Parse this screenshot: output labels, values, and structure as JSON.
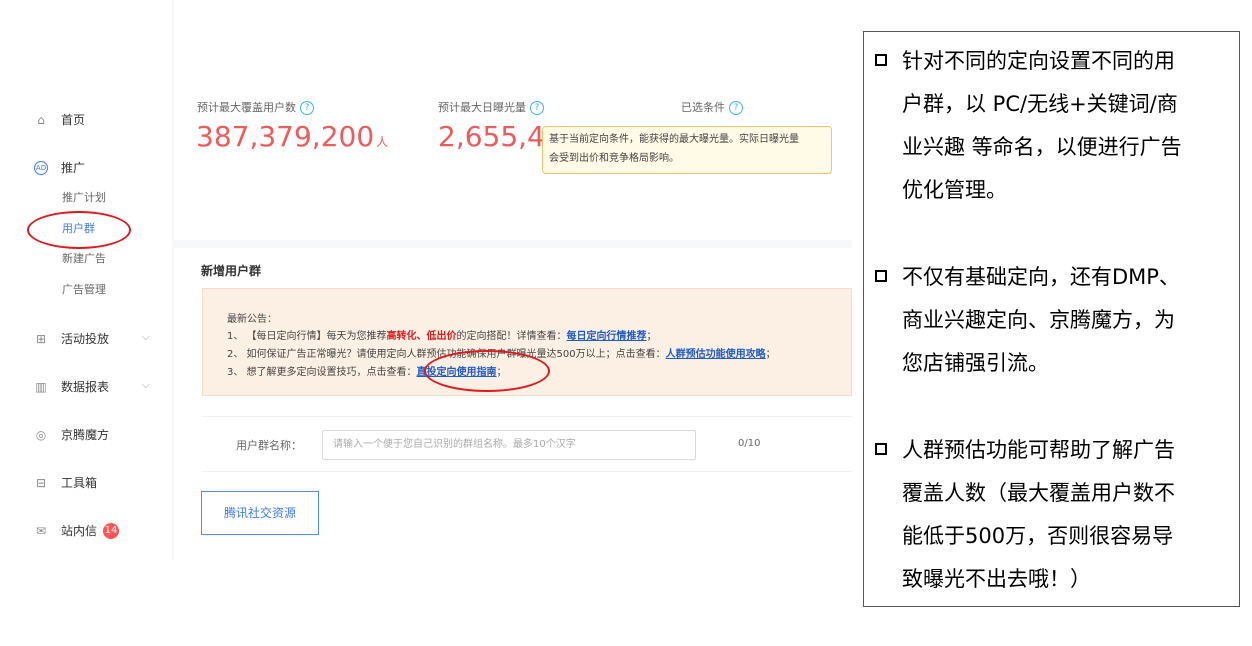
{
  "sidebar": {
    "home": "首页",
    "promo": "推广",
    "promo_icon": "AD",
    "promo_plan": "推广计划",
    "user_group": "用户群",
    "new_ad": "新建广告",
    "ad_manage": "广告管理",
    "activity": "活动投放",
    "reports": "数据报表",
    "jingteng": "京腾魔方",
    "toolbox": "工具箱",
    "messages": "站内信",
    "messages_badge": "14"
  },
  "stats": {
    "coverage_label": "预计最大覆盖用户数",
    "coverage_value": "387,379,200",
    "coverage_unit": "人",
    "exposure_label": "预计最大日曝光量",
    "exposure_value": "2,655,4",
    "selected_label": "已选条件",
    "tooltip_line1": "基于当前定向条件，能获得的最大曝光量。实际日曝光量",
    "tooltip_line2": "会受到出价和竞争格局影响。"
  },
  "form": {
    "section_title": "新增用户群",
    "notice_title": "最新公告：",
    "notice1_a": "1、 【每日定向行情】每天为您推荐",
    "notice1_hl": "高转化、低出价",
    "notice1_b": "的定向搭配！详情查看：",
    "notice1_link": "每日定向行情推荐",
    "notice1_end": "；",
    "notice2_a": "2、 如何保证广告正常曝光？请使用定向人群预估功能确保用户群曝光量达500万以上；点击查看：",
    "notice2_link": "人群预估功能使用攻略",
    "notice2_end": "；",
    "notice3_a": "3、 想了解更多定向设置技巧，点击查看：",
    "notice3_link": "直投定向使用指南",
    "notice3_end": "；",
    "name_label": "用户群名称：",
    "name_placeholder": "请输入一个便于您自己识别的群组名称。最多10个汉字",
    "name_count": "0/10",
    "resource_button": "腾讯社交资源"
  },
  "info": {
    "b1_l1": "针对不同的定向设置不同的用",
    "b1_l2": "户群，以 PC/无线+关键词/商",
    "b1_l3": "业兴趣 等命名，以便进行广告",
    "b1_l4": "优化管理。",
    "b2_l1": "不仅有基础定向，还有DMP、",
    "b2_l2": "商业兴趣定向、京腾魔方，为",
    "b2_l3": "您店铺强引流。",
    "b3_l1": "人群预估功能可帮助了解广告",
    "b3_l2": "覆盖人数（最大覆盖用户数不",
    "b3_l3": "能低于500万，否则很容易导",
    "b3_l4": "致曝光不出去哦！）"
  },
  "colors": {
    "accent_blue": "#3d7bf7",
    "stat_red": "#f05a5a",
    "annotation_red": "#e0191c"
  }
}
